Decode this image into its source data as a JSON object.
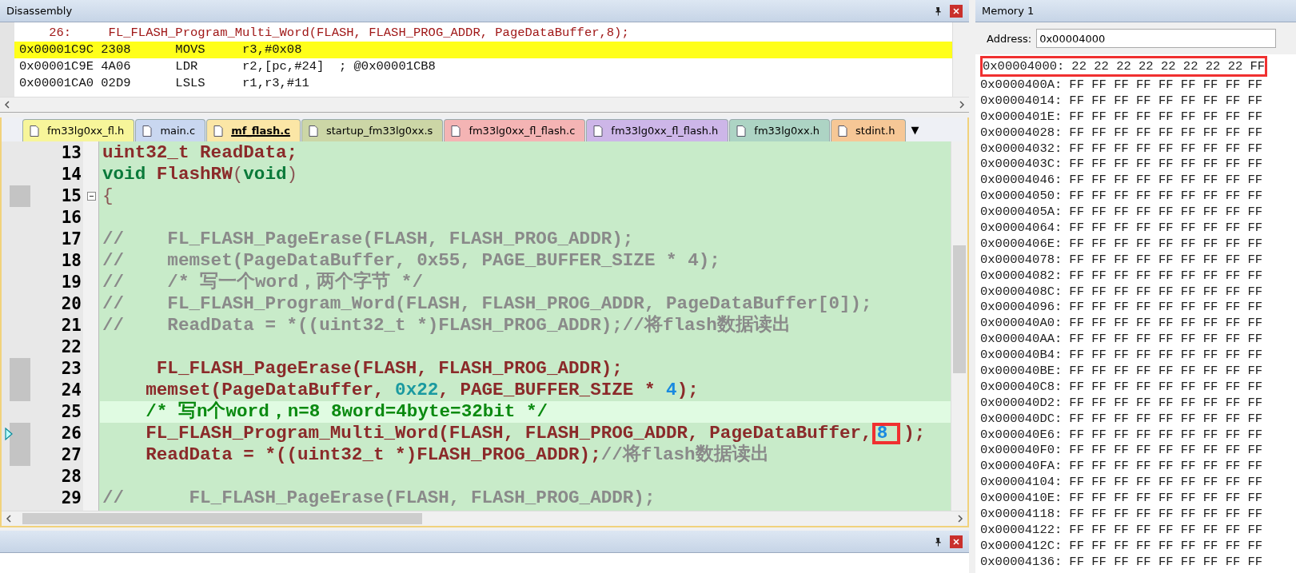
{
  "disassembly": {
    "title": "Disassembly",
    "rows": [
      {
        "kind": "source",
        "text": "    26:     FL_FLASH_Program_Multi_Word(FLASH, FLASH_PROG_ADDR, PageDataBuffer,8);",
        "selected": false
      },
      {
        "kind": "asm",
        "text": "0x00001C9C 2308      MOVS     r3,#0x08",
        "selected": true
      },
      {
        "kind": "asm",
        "text": "0x00001C9E 4A06      LDR      r2,[pc,#24]  ; @0x00001CB8",
        "selected": false
      },
      {
        "kind": "asm",
        "text": "0x00001CA0 02D9      LSLS     r1,r3,#11",
        "selected": false
      }
    ]
  },
  "editor": {
    "tabs": [
      {
        "label": "fm33lg0xx_fl.h",
        "color": "#f7f59a",
        "selected": false
      },
      {
        "label": "main.c",
        "color": "#c9d7f0",
        "selected": false
      },
      {
        "label": "mf_flash.c",
        "color": "#fbe6a6",
        "selected": true
      },
      {
        "label": "startup_fm33lg0xx.s",
        "color": "#ccd6a6",
        "selected": false
      },
      {
        "label": "fm33lg0xx_fl_flash.c",
        "color": "#f4b4b4",
        "selected": false
      },
      {
        "label": "fm33lg0xx_fl_flash.h",
        "color": "#cdb6e8",
        "selected": false
      },
      {
        "label": "fm33lg0xx.h",
        "color": "#add4c4",
        "selected": false
      },
      {
        "label": "stdint.h",
        "color": "#f6c796",
        "selected": false
      }
    ],
    "tab_menu": "▼",
    "lines": [
      {
        "number": "13",
        "marked": false,
        "current": false,
        "pointer": false,
        "fold": false,
        "segments": [
          {
            "kind": "code",
            "text": "uint32_t ReadData;"
          }
        ]
      },
      {
        "number": "14",
        "marked": false,
        "current": false,
        "pointer": false,
        "fold": false,
        "segments": [
          {
            "kind": "keyword",
            "text": "void"
          },
          {
            "kind": "code",
            "text": " FlashRW"
          },
          {
            "kind": "punct",
            "text": "("
          },
          {
            "kind": "keyword",
            "text": "void"
          },
          {
            "kind": "punct",
            "text": ")"
          }
        ]
      },
      {
        "number": "15",
        "marked": true,
        "current": false,
        "pointer": false,
        "fold": true,
        "segments": [
          {
            "kind": "punct",
            "text": "{"
          }
        ]
      },
      {
        "number": "16",
        "marked": false,
        "current": false,
        "pointer": false,
        "fold": false
      },
      {
        "number": "17",
        "marked": false,
        "current": false,
        "pointer": false,
        "fold": false,
        "segments": [
          {
            "kind": "comment",
            "text": "//    FL_FLASH_PageErase(FLASH, FLASH_PROG_ADDR);"
          }
        ]
      },
      {
        "number": "18",
        "marked": false,
        "current": false,
        "pointer": false,
        "fold": false,
        "segments": [
          {
            "kind": "comment",
            "text": "//    memset(PageDataBuffer, 0x55, PAGE_BUFFER_SIZE * 4);"
          }
        ]
      },
      {
        "number": "19",
        "marked": false,
        "current": false,
        "pointer": false,
        "fold": false,
        "segments": [
          {
            "kind": "comment",
            "text": "//    /* 写一个word，两个字节 */"
          }
        ]
      },
      {
        "number": "20",
        "marked": false,
        "current": false,
        "pointer": false,
        "fold": false,
        "segments": [
          {
            "kind": "comment",
            "text": "//    FL_FLASH_Program_Word(FLASH, FLASH_PROG_ADDR, PageDataBuffer[0]);"
          }
        ]
      },
      {
        "number": "21",
        "marked": false,
        "current": false,
        "pointer": false,
        "fold": false,
        "segments": [
          {
            "kind": "comment",
            "text": "//    ReadData = *((uint32_t *)FLASH_PROG_ADDR);//将flash数据读出"
          }
        ]
      },
      {
        "number": "22",
        "marked": false,
        "current": false,
        "pointer": false,
        "fold": false
      },
      {
        "number": "23",
        "marked": true,
        "current": false,
        "pointer": false,
        "fold": false,
        "segments": [
          {
            "kind": "code",
            "text": "     FL_FLASH_PageErase(FLASH, FLASH_PROG_ADDR);"
          }
        ]
      },
      {
        "number": "24",
        "marked": true,
        "current": false,
        "pointer": false,
        "fold": false,
        "segments": [
          {
            "kind": "code",
            "text": "    memset(PageDataBuffer, "
          },
          {
            "kind": "hex",
            "text": "0x22"
          },
          {
            "kind": "code",
            "text": ", PAGE_BUFFER_SIZE * "
          },
          {
            "kind": "number",
            "text": "4"
          },
          {
            "kind": "code",
            "text": ");"
          }
        ]
      },
      {
        "number": "25",
        "marked": false,
        "current": true,
        "pointer": false,
        "fold": false,
        "segments": [
          {
            "kind": "active-comment",
            "text": "    /* 写n个word，n=8 8word=4byte=32bit */"
          }
        ]
      },
      {
        "number": "26",
        "marked": true,
        "current": false,
        "pointer": true,
        "fold": false,
        "segments": [
          {
            "kind": "code",
            "text": "    FL_FLASH_Program_Multi_Word(FLASH, FLASH_PROG_ADDR, PageDataBuffer,"
          },
          {
            "kind": "number",
            "text": "8",
            "boxed": true
          },
          {
            "kind": "code",
            "text": ");"
          }
        ]
      },
      {
        "number": "27",
        "marked": true,
        "current": false,
        "pointer": false,
        "fold": false,
        "segments": [
          {
            "kind": "code",
            "text": "    ReadData = *((uint32_t *)FLASH_PROG_ADDR);"
          },
          {
            "kind": "comment",
            "text": "//将flash数据读出"
          }
        ]
      },
      {
        "number": "28",
        "marked": false,
        "current": false,
        "pointer": false,
        "fold": false
      },
      {
        "number": "29",
        "marked": false,
        "current": false,
        "pointer": false,
        "fold": false,
        "segments": [
          {
            "kind": "comment",
            "text": "//      FL_FLASH_PageErase(FLASH, FLASH_PROG_ADDR);"
          }
        ]
      }
    ]
  },
  "memory": {
    "title": "Memory 1",
    "address_label": "Address:",
    "address_value": "0x00004000",
    "rows": [
      {
        "address": "0x00004000:",
        "bytes": "22 22 22 22 22 22 22 22 FF",
        "boxed": true
      },
      {
        "address": "0x0000400A:",
        "bytes": "FF FF FF FF FF FF FF FF FF",
        "boxed": false
      },
      {
        "address": "0x00004014:",
        "bytes": "FF FF FF FF FF FF FF FF FF",
        "boxed": false
      },
      {
        "address": "0x0000401E:",
        "bytes": "FF FF FF FF FF FF FF FF FF",
        "boxed": false
      },
      {
        "address": "0x00004028:",
        "bytes": "FF FF FF FF FF FF FF FF FF",
        "boxed": false
      },
      {
        "address": "0x00004032:",
        "bytes": "FF FF FF FF FF FF FF FF FF",
        "boxed": false
      },
      {
        "address": "0x0000403C:",
        "bytes": "FF FF FF FF FF FF FF FF FF",
        "boxed": false
      },
      {
        "address": "0x00004046:",
        "bytes": "FF FF FF FF FF FF FF FF FF",
        "boxed": false
      },
      {
        "address": "0x00004050:",
        "bytes": "FF FF FF FF FF FF FF FF FF",
        "boxed": false
      },
      {
        "address": "0x0000405A:",
        "bytes": "FF FF FF FF FF FF FF FF FF",
        "boxed": false
      },
      {
        "address": "0x00004064:",
        "bytes": "FF FF FF FF FF FF FF FF FF",
        "boxed": false
      },
      {
        "address": "0x0000406E:",
        "bytes": "FF FF FF FF FF FF FF FF FF",
        "boxed": false
      },
      {
        "address": "0x00004078:",
        "bytes": "FF FF FF FF FF FF FF FF FF",
        "boxed": false
      },
      {
        "address": "0x00004082:",
        "bytes": "FF FF FF FF FF FF FF FF FF",
        "boxed": false
      },
      {
        "address": "0x0000408C:",
        "bytes": "FF FF FF FF FF FF FF FF FF",
        "boxed": false
      },
      {
        "address": "0x00004096:",
        "bytes": "FF FF FF FF FF FF FF FF FF",
        "boxed": false
      },
      {
        "address": "0x000040A0:",
        "bytes": "FF FF FF FF FF FF FF FF FF",
        "boxed": false
      },
      {
        "address": "0x000040AA:",
        "bytes": "FF FF FF FF FF FF FF FF FF",
        "boxed": false
      },
      {
        "address": "0x000040B4:",
        "bytes": "FF FF FF FF FF FF FF FF FF",
        "boxed": false
      },
      {
        "address": "0x000040BE:",
        "bytes": "FF FF FF FF FF FF FF FF FF",
        "boxed": false
      },
      {
        "address": "0x000040C8:",
        "bytes": "FF FF FF FF FF FF FF FF FF",
        "boxed": false
      },
      {
        "address": "0x000040D2:",
        "bytes": "FF FF FF FF FF FF FF FF FF",
        "boxed": false
      },
      {
        "address": "0x000040DC:",
        "bytes": "FF FF FF FF FF FF FF FF FF",
        "boxed": false
      },
      {
        "address": "0x000040E6:",
        "bytes": "FF FF FF FF FF FF FF FF FF",
        "boxed": false
      },
      {
        "address": "0x000040F0:",
        "bytes": "FF FF FF FF FF FF FF FF FF",
        "boxed": false
      },
      {
        "address": "0x000040FA:",
        "bytes": "FF FF FF FF FF FF FF FF FF",
        "boxed": false
      },
      {
        "address": "0x00004104:",
        "bytes": "FF FF FF FF FF FF FF FF FF",
        "boxed": false
      },
      {
        "address": "0x0000410E:",
        "bytes": "FF FF FF FF FF FF FF FF FF",
        "boxed": false
      },
      {
        "address": "0x00004118:",
        "bytes": "FF FF FF FF FF FF FF FF FF",
        "boxed": false
      },
      {
        "address": "0x00004122:",
        "bytes": "FF FF FF FF FF FF FF FF FF",
        "boxed": false
      },
      {
        "address": "0x0000412C:",
        "bytes": "FF FF FF FF FF FF FF FF FF",
        "boxed": false
      },
      {
        "address": "0x00004136:",
        "bytes": "FF FF FF FF FF FF FF FF FF",
        "boxed": false
      }
    ]
  }
}
